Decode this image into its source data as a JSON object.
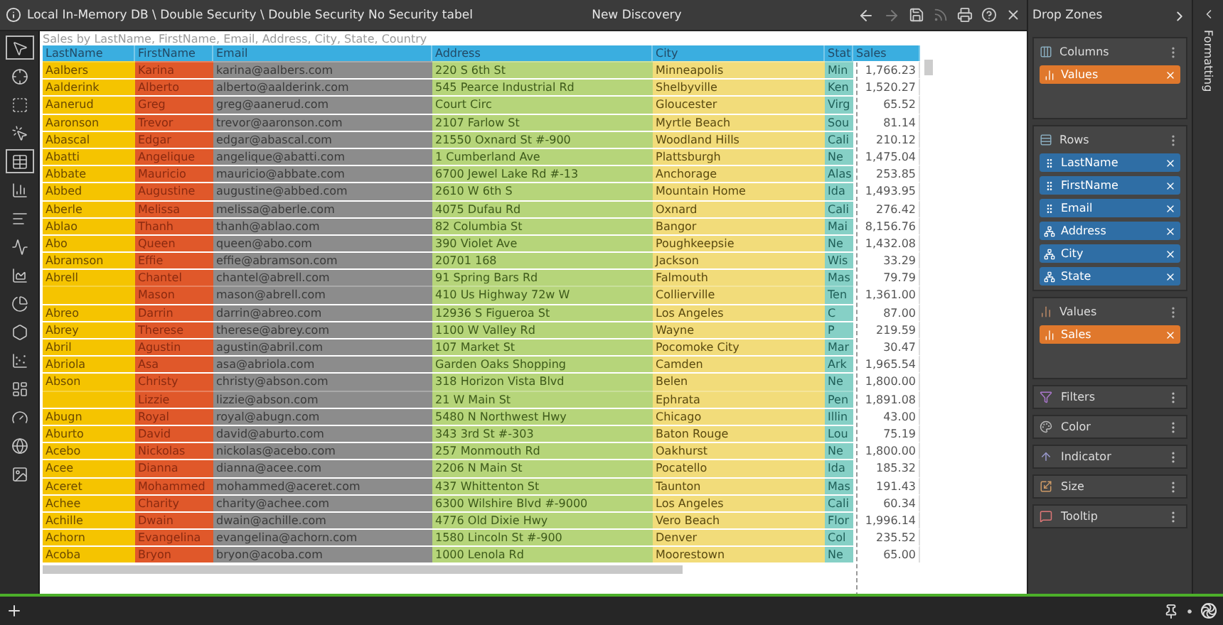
{
  "header": {
    "path": "Local In-Memory DB \\ Double Security \\ Double Security No Security tabel",
    "title": "New Discovery"
  },
  "tools": [
    {
      "kind": "pointer",
      "selected": true
    },
    {
      "kind": "crosshair",
      "selected": false
    },
    {
      "kind": "lasso",
      "selected": false
    },
    {
      "kind": "pointer-alt",
      "selected": false
    },
    {
      "kind": "grid",
      "selected": true
    },
    {
      "kind": "bars",
      "selected": false
    },
    {
      "kind": "hbars",
      "selected": false
    },
    {
      "kind": "line",
      "selected": false
    },
    {
      "kind": "area",
      "selected": false
    },
    {
      "kind": "pie",
      "selected": false
    },
    {
      "kind": "radar",
      "selected": false
    },
    {
      "kind": "scatter",
      "selected": false
    },
    {
      "kind": "treemap",
      "selected": false
    },
    {
      "kind": "gauge",
      "selected": false
    },
    {
      "kind": "globe",
      "selected": false
    },
    {
      "kind": "image",
      "selected": false
    }
  ],
  "table": {
    "caption": "Sales by LastName, FirstName, Email, Address, City, State, Country",
    "columns": [
      {
        "label": "LastName",
        "color": "#f5c400"
      },
      {
        "label": "FirstName",
        "color": "#e0582a"
      },
      {
        "label": "Email",
        "color": "#8c8c8c"
      },
      {
        "label": "Address",
        "color": "#b6d57a"
      },
      {
        "label": "City",
        "color": "#f2dc7a"
      },
      {
        "label": "Stat",
        "color": "#86d0c6"
      },
      {
        "label": "Sales",
        "color": "#ffffff"
      }
    ],
    "rows": [
      {
        "last_name": "Aalbers",
        "first_name": "Karina",
        "email": "karina@aalbers.com",
        "address": "220 S 6th St",
        "city": "Minneapolis",
        "state": "Min",
        "sales": "1,766.23"
      },
      {
        "last_name": "Aalderink",
        "first_name": "Alberto",
        "email": "alberto@aalderink.com",
        "address": "545 Pearce Industrial Rd",
        "city": "Shelbyville",
        "state": "Ken",
        "sales": "1,520.27"
      },
      {
        "last_name": "Aanerud",
        "first_name": "Greg",
        "email": "greg@aanerud.com",
        "address": "Court Circ",
        "city": "Gloucester",
        "state": "Virg",
        "sales": "65.52"
      },
      {
        "last_name": "Aaronson",
        "first_name": "Trevor",
        "email": "trevor@aaronson.com",
        "address": "2107 Farlow St",
        "city": "Myrtle Beach",
        "state": "Sou",
        "sales": "81.14"
      },
      {
        "last_name": "Abascal",
        "first_name": "Edgar",
        "email": "edgar@abascal.com",
        "address": "21550 Oxnard St #-900",
        "city": "Woodland Hills",
        "state": "Cali",
        "sales": "210.12"
      },
      {
        "last_name": "Abatti",
        "first_name": "Angelique",
        "email": "angelique@abatti.com",
        "address": "1 Cumberland Ave",
        "city": "Plattsburgh",
        "state": "Ne",
        "sales": "1,475.04"
      },
      {
        "last_name": "Abbate",
        "first_name": "Mauricio",
        "email": "mauricio@abbate.com",
        "address": "6700 Jewel Lake Rd #-13",
        "city": "Anchorage",
        "state": "Alas",
        "sales": "253.85"
      },
      {
        "last_name": "Abbed",
        "first_name": "Augustine",
        "email": "augustine@abbed.com",
        "address": "2610 W 6th S",
        "city": "Mountain Home",
        "state": "Ida",
        "sales": "1,493.95"
      },
      {
        "last_name": "Aberle",
        "first_name": "Melissa",
        "email": "melissa@aberle.com",
        "address": "4075 Dufau Rd",
        "city": "Oxnard",
        "state": "Cali",
        "sales": "276.42"
      },
      {
        "last_name": "Ablao",
        "first_name": "Thanh",
        "email": "thanh@ablao.com",
        "address": "82 Columbia St",
        "city": "Bangor",
        "state": "Mai",
        "sales": "8,156.76"
      },
      {
        "last_name": "Abo",
        "first_name": "Queen",
        "email": "queen@abo.com",
        "address": "390 Violet Ave",
        "city": "Poughkeepsie",
        "state": "Ne",
        "sales": "1,432.08"
      },
      {
        "last_name": "Abramson",
        "first_name": "Effie",
        "email": "effie@abramson.com",
        "address": "20701 168",
        "city": "Jackson",
        "state": "Wis",
        "sales": "33.29"
      },
      {
        "last_name": "Abrell",
        "first_name": "Chantel",
        "email": "chantel@abrell.com",
        "address": "91 Spring Bars Rd",
        "city": "Falmouth",
        "state": "Mas",
        "sales": "79.79"
      },
      {
        "first_name": "Mason",
        "email": "mason@abrell.com",
        "address": "410 Us Highway 72w W",
        "city": "Collierville",
        "state": "Ten",
        "sales": "1,361.00"
      },
      {
        "last_name": "Abreo",
        "first_name": "Darrin",
        "email": "darrin@abreo.com",
        "address": "12936 S Figueroa St",
        "city": "Los Angeles",
        "state": "C",
        "sales": "87.00"
      },
      {
        "last_name": "Abrey",
        "first_name": "Therese",
        "email": "therese@abrey.com",
        "address": "1100 W Valley Rd",
        "city": "Wayne",
        "state": "P",
        "sales": "219.59"
      },
      {
        "last_name": "Abril",
        "first_name": "Agustin",
        "email": "agustin@abril.com",
        "address": "107 Market St",
        "city": "Pocomoke City",
        "state": "Mar",
        "sales": "30.47"
      },
      {
        "last_name": "Abriola",
        "first_name": "Asa",
        "email": "asa@abriola.com",
        "address": "Garden Oaks Shopping",
        "city": "Camden",
        "state": "Ark",
        "sales": "1,965.54"
      },
      {
        "last_name": "Abson",
        "first_name": "Christy",
        "email": "christy@abson.com",
        "address": "318 Horizon Vista Blvd",
        "city": "Belen",
        "state": "Ne",
        "sales": "1,800.00"
      },
      {
        "first_name": "Lizzie",
        "email": "lizzie@abson.com",
        "address": "21 W Main St",
        "city": "Ephrata",
        "state": "Pen",
        "sales": "1,891.08"
      },
      {
        "last_name": "Abugn",
        "first_name": "Royal",
        "email": "royal@abugn.com",
        "address": "5480 N Northwest Hwy",
        "city": "Chicago",
        "state": "Illin",
        "sales": "43.00"
      },
      {
        "last_name": "Aburto",
        "first_name": "David",
        "email": "david@aburto.com",
        "address": "343 3rd St #-303",
        "city": "Baton Rouge",
        "state": "Lou",
        "sales": "75.19"
      },
      {
        "last_name": "Acebo",
        "first_name": "Nickolas",
        "email": "nickolas@acebo.com",
        "address": "257 Monmouth Rd",
        "city": "Oakhurst",
        "state": "Ne",
        "sales": "1,800.00"
      },
      {
        "last_name": "Acee",
        "first_name": "Dianna",
        "email": "dianna@acee.com",
        "address": "2206 N Main St",
        "city": "Pocatello",
        "state": "Ida",
        "sales": "185.32"
      },
      {
        "last_name": "Aceret",
        "first_name": "Mohammed",
        "email": "mohammed@aceret.com",
        "address": "437 Whittenton St",
        "city": "Taunton",
        "state": "Mas",
        "sales": "191.43"
      },
      {
        "last_name": "Achee",
        "first_name": "Charity",
        "email": "charity@achee.com",
        "address": "6300 Wilshire Blvd #-9000",
        "city": "Los Angeles",
        "state": "Cali",
        "sales": "60.34"
      },
      {
        "last_name": "Achille",
        "first_name": "Dwain",
        "email": "dwain@achille.com",
        "address": "4776 Old Dixie Hwy",
        "city": "Vero Beach",
        "state": "Flor",
        "sales": "1,996.14"
      },
      {
        "last_name": "Achorn",
        "first_name": "Evangelina",
        "email": "evangelina@achorn.com",
        "address": "1580 Lincoln St #-900",
        "city": "Denver",
        "state": "Col",
        "sales": "235.52"
      },
      {
        "last_name": "Acoba",
        "first_name": "Bryon",
        "email": "bryon@acoba.com",
        "address": "1000 Lenola Rd",
        "city": "Moorestown",
        "state": "Ne",
        "sales": "65.00"
      }
    ]
  },
  "drop_zones": {
    "title": "Drop Zones",
    "zones": [
      {
        "kind": "columns",
        "label": "Columns",
        "chips": [
          {
            "kind": "measure",
            "label": "Values"
          }
        ]
      },
      {
        "kind": "rows",
        "label": "Rows",
        "chips": [
          {
            "kind": "field",
            "label": "LastName"
          },
          {
            "kind": "field",
            "label": "FirstName"
          },
          {
            "kind": "field",
            "label": "Email"
          },
          {
            "kind": "hierarchy",
            "label": "Address"
          },
          {
            "kind": "hierarchy",
            "label": "City"
          },
          {
            "kind": "hierarchy",
            "label": "State"
          }
        ]
      },
      {
        "kind": "values",
        "label": "Values",
        "chips": [
          {
            "kind": "measure",
            "label": "Sales"
          }
        ]
      }
    ],
    "collapsed": [
      {
        "kind": "filters",
        "label": "Filters"
      },
      {
        "kind": "color",
        "label": "Color"
      },
      {
        "kind": "indicator",
        "label": "Indicator"
      },
      {
        "kind": "size",
        "label": "Size"
      },
      {
        "kind": "tooltip",
        "label": "Tooltip"
      }
    ]
  },
  "formatting": {
    "label": "Formatting"
  }
}
